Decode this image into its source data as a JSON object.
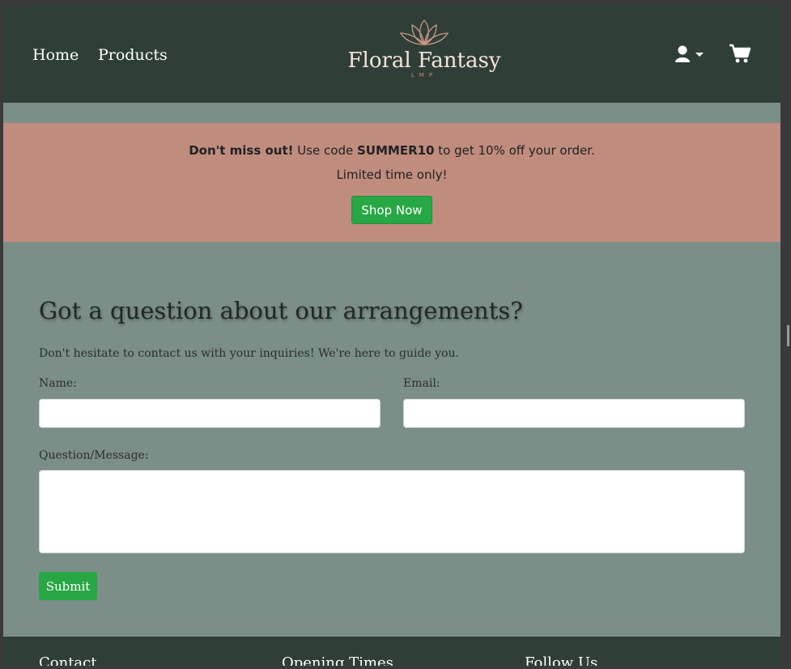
{
  "nav": {
    "home_label": "Home",
    "products_label": "Products",
    "brand_name": "Floral Fantasy",
    "brand_sub": "LMP",
    "user_icon": "user-icon",
    "cart_icon": "cart-icon"
  },
  "promo": {
    "bold_text": "Don't miss out!",
    "text_before_code": " Use code ",
    "code": "SUMMER10",
    "text_after_code": " to get 10% off your order.",
    "line2": "Limited time only!",
    "button_label": "Shop Now"
  },
  "contact": {
    "title": "Got a question about our arrangements?",
    "intro": "Don't hesitate to contact us with your inquiries! We're here to guide you.",
    "name_label": "Name:",
    "name_value": "",
    "email_label": "Email:",
    "email_value": "",
    "message_label": "Question/Message:",
    "message_value": "",
    "submit_label": "Submit"
  },
  "footer": {
    "contact_heading": "Contact",
    "hours_heading": "Opening Times",
    "social_heading": "Follow Us"
  },
  "colors": {
    "navbar": "#2f3f37",
    "page_bg": "#7b8e88",
    "promo_bg": "#bf8c7e",
    "button_green": "#28a745"
  }
}
